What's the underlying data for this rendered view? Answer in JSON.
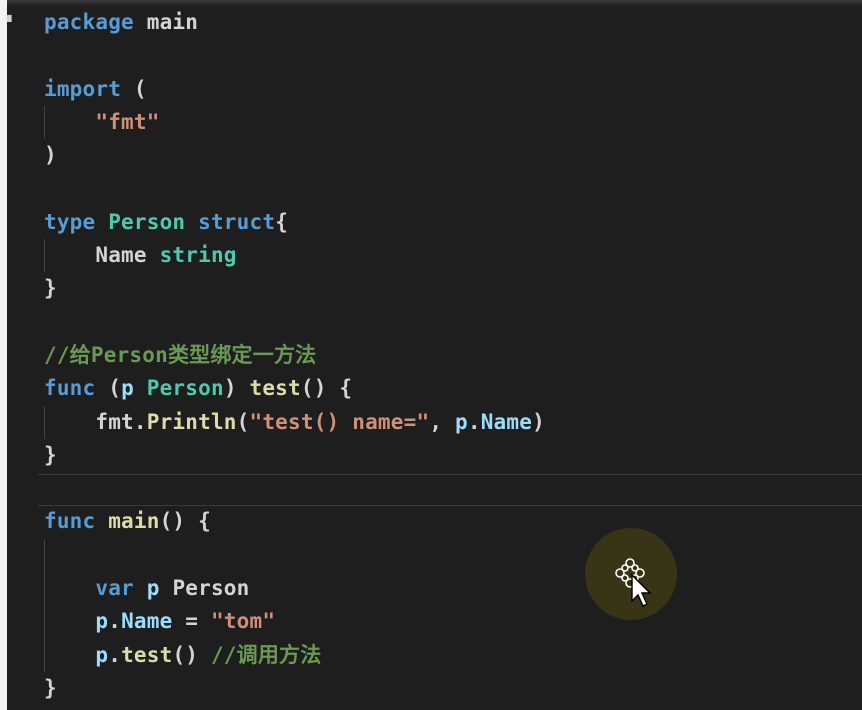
{
  "colors": {
    "background": "#1e1e1e",
    "keyword": "#569cd6",
    "type": "#4ec9b0",
    "string": "#ce9178",
    "comment": "#6a9955",
    "function": "#dcdcaa",
    "variable": "#9cdcfe",
    "text": "#d4d4d4"
  },
  "cursor": {
    "icon": "move-cursor-icon"
  },
  "code": {
    "line1": {
      "kw": "package",
      "name": " main"
    },
    "line3": {
      "kw": "import",
      "rest": " ("
    },
    "line4": {
      "str": "\"fmt\""
    },
    "line5": {
      "text": ")"
    },
    "line7": {
      "kw": "type",
      "sp": " ",
      "ty": "Person",
      "sp2": " ",
      "kw2": "struct",
      "rest": "{"
    },
    "line8": {
      "field": "Name",
      "sp": " ",
      "ty": "string"
    },
    "line9": {
      "text": "}"
    },
    "line11": {
      "comment": "//给Person类型绑定一方法"
    },
    "line12": {
      "kw": "func",
      "p1": " (",
      "var": "p",
      "sp": " ",
      "ty": "Person",
      "p2": ") ",
      "fn": "test",
      "rest": "() {"
    },
    "line13": {
      "pkg": "fmt",
      "dot": ".",
      "fn": "Println",
      "p1": "(",
      "str": "\"test() name=\"",
      "p2": ", ",
      "var": "p",
      "dot2": ".",
      "field": "Name",
      "p3": ")"
    },
    "line14": {
      "text": "}"
    },
    "line16": {
      "kw": "func",
      "sp": " ",
      "fn": "main",
      "rest": "() {"
    },
    "line18": {
      "kw": "var",
      "sp": " ",
      "var": "p",
      "sp2": " ",
      "ty": "Person"
    },
    "line19": {
      "var": "p",
      "dot": ".",
      "field": "Name",
      "eq": " = ",
      "str": "\"tom\""
    },
    "line20": {
      "var": "p",
      "dot": ".",
      "fn": "test",
      "rest": "() ",
      "comment": "//调用方法"
    },
    "line21": {
      "text": "}"
    }
  }
}
